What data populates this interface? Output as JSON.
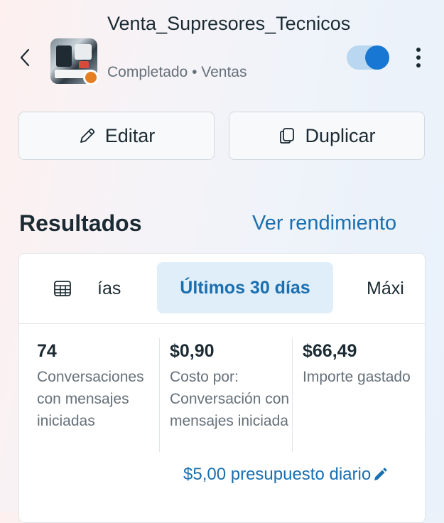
{
  "header": {
    "campaign_name": "Venta_Supresores_Tecnicos",
    "status": "Completado",
    "separator": " • ",
    "objective": "Ventas",
    "toggle_on": true
  },
  "actions": {
    "edit_label": "Editar",
    "duplicate_label": "Duplicar"
  },
  "results": {
    "title": "Resultados",
    "link_label": "Ver rendimiento",
    "tabs": [
      {
        "label": "ías",
        "active": false
      },
      {
        "label": "Últimos 30 días",
        "active": true
      },
      {
        "label": "Máxi",
        "active": false
      }
    ],
    "metrics": [
      {
        "value": "74",
        "label": "Conversaciones con mensajes iniciadas"
      },
      {
        "value": "$0,90",
        "label": "Costo por: Conversación con mensajes iniciada"
      },
      {
        "value": "$66,49",
        "label": "Importe gastado"
      }
    ],
    "budget_label": "$5,00 presupuesto diario"
  },
  "colors": {
    "accent": "#1877d2",
    "link": "#1a6fb0",
    "status_dot": "#e67e22"
  }
}
